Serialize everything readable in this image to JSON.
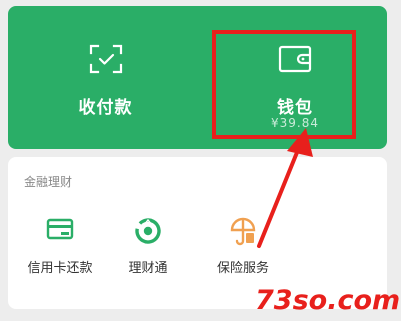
{
  "top_card": {
    "receive_pay_label": "收付款",
    "wallet_label": "钱包",
    "wallet_balance": "¥39.84",
    "background_color": "#2aae67"
  },
  "finance": {
    "section_title": "金融理财",
    "items": [
      {
        "label": "信用卡还款",
        "icon": "credit-card-icon",
        "color": "#2aae67"
      },
      {
        "label": "理财通",
        "icon": "wealth-management-icon",
        "color": "#2aae67"
      },
      {
        "label": "保险服务",
        "icon": "insurance-umbrella-icon",
        "color": "#f0a050"
      }
    ]
  },
  "annotation": {
    "highlight_color": "#e8201c"
  },
  "watermark": "73so.com"
}
